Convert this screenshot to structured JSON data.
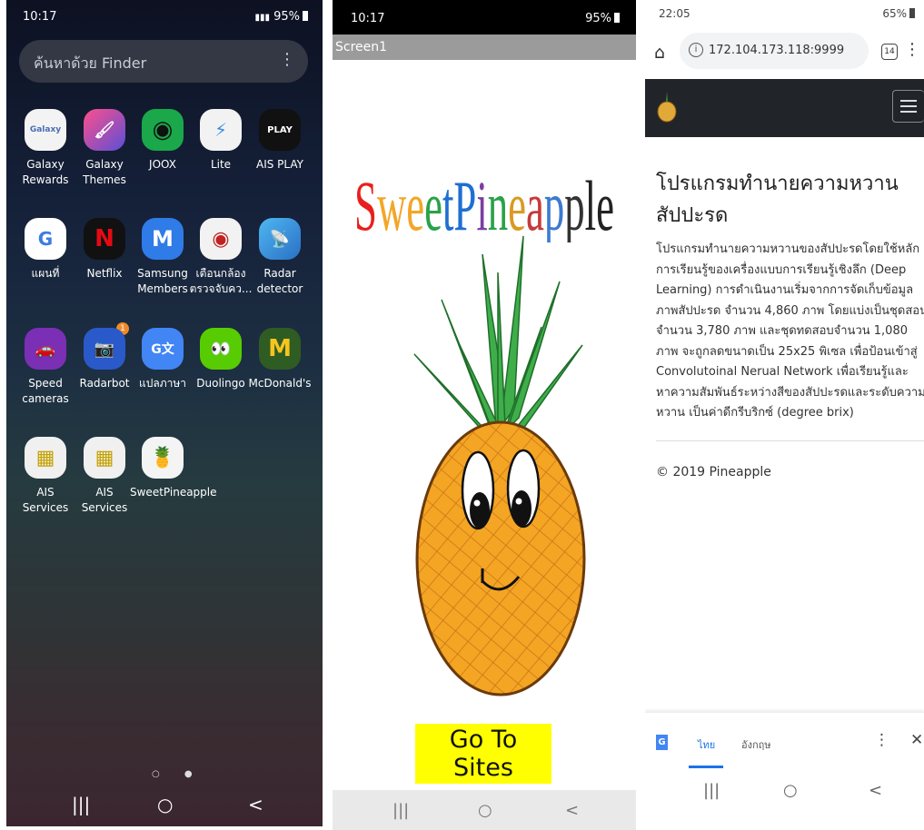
{
  "home": {
    "status": {
      "time": "10:17",
      "battery": "95%"
    },
    "search_placeholder": "ค้นหาด้วย Finder",
    "apps": [
      {
        "label": "Galaxy Rewards",
        "glyph": "Galaxy"
      },
      {
        "label": "Galaxy Themes",
        "glyph": "🖌"
      },
      {
        "label": "JOOX",
        "glyph": "◉"
      },
      {
        "label": "Lite",
        "glyph": "⚡"
      },
      {
        "label": "AIS PLAY",
        "glyph": "PLAY"
      },
      {
        "label": "แผนที่",
        "glyph": "G"
      },
      {
        "label": "Netflix",
        "glyph": "N"
      },
      {
        "label": "Samsung Members",
        "glyph": "M"
      },
      {
        "label": "เตือนกล้อง ตรวจจับคว...",
        "glyph": "◉"
      },
      {
        "label": "Radar detector",
        "glyph": "📡"
      },
      {
        "label": "Speed cameras",
        "glyph": "🚗"
      },
      {
        "label": "Radarbot",
        "glyph": "📷",
        "badge": "1"
      },
      {
        "label": "แปลภาษา",
        "glyph": "G文"
      },
      {
        "label": "Duolingo",
        "glyph": "👀"
      },
      {
        "label": "McDonald's",
        "glyph": "M"
      },
      {
        "label": "AIS Services",
        "glyph": "▦"
      },
      {
        "label": "AIS Services",
        "glyph": "▦"
      },
      {
        "label": "SweetPineapple",
        "glyph": "🍍"
      }
    ],
    "pager": "○ ●",
    "nav": [
      "|||",
      "○",
      "<"
    ]
  },
  "app": {
    "status": {
      "time": "10:17",
      "battery": "95%"
    },
    "screen_title": "Screen1",
    "logo_text": "SweetPineapple",
    "logo_colors": [
      "#e8201c",
      "#f2a628",
      "#f2a628",
      "#2aa24a",
      "#1e6fd1",
      "#1e6fd1",
      "#7a3fa0",
      "#2aa24a",
      "#d99a24",
      "#c73a3a",
      "#3a7bd1",
      "#333333",
      "#222222",
      "#222222"
    ],
    "go_button": "Go To Sites",
    "nav": [
      "|||",
      "○",
      "<"
    ]
  },
  "browser": {
    "status": {
      "time": "22:05",
      "battery": "65%"
    },
    "url": "172.104.173.118:9999",
    "tab_count": "14",
    "heading": "โปรแกรมทำนายความหวานสัปปะรด",
    "paragraph": "โปรแกรมทำนายความหวานของสัปปะรดโดยใช้หลักการเรียนรู้ของเครื่องแบบการเรียนรู้เชิงลึก (Deep Learning) การดำเนินงานเริ่มจากการจัดเก็บข้อมูลภาพสัปปะรด จำนวน 4,860 ภาพ โดยแบ่งเป็นชุดสอน จำนวน 3,780 ภาพ และชุดทดสอบจำนวน 1,080 ภาพ จะถูกลดขนาดเป็น 25x25 พิเซล เพื่อป้อนเข้าสู่ Convolutoinal Nerual Network เพื่อเรียนรู้และหาความสัมพันธ์ระหว่างสีของสัปปะรดและระดับความหวาน เป็นค่าดีกรีบริกซ์ (degree brix)",
    "footer": "© 2019 Pineapple",
    "translate": {
      "lang_active": "ไทย",
      "lang_other": "อังกฤษ"
    },
    "nav": [
      "|||",
      "○",
      "<"
    ]
  }
}
